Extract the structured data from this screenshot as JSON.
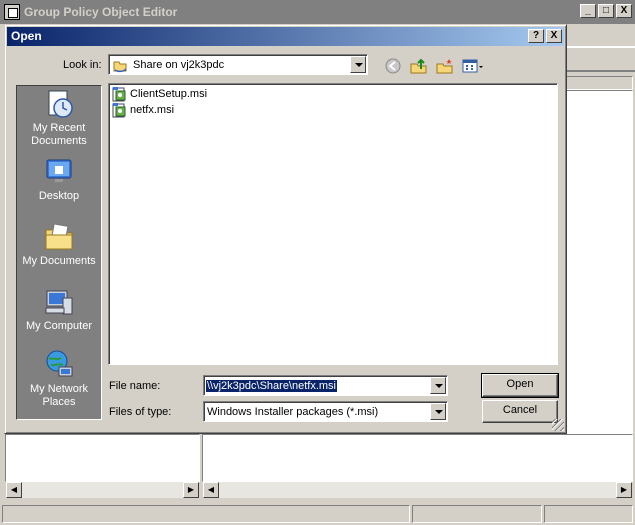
{
  "background_window": {
    "title": "Group Policy Object Editor",
    "caption_buttons": [
      "_",
      "□",
      "X"
    ]
  },
  "dialog": {
    "title": "Open",
    "title_buttons": [
      "?",
      "X"
    ],
    "look_in_label": "Look in:",
    "look_in_value": "Share on vj2k3pdc",
    "toolbar_icons": [
      "back-icon",
      "up-folder-icon",
      "new-folder-icon",
      "view-menu-icon"
    ],
    "places": [
      {
        "label_line1": "My Recent",
        "label_line2": "Documents",
        "icon": "recent-documents-icon"
      },
      {
        "label_line1": "Desktop",
        "label_line2": "",
        "icon": "desktop-icon"
      },
      {
        "label_line1": "My Documents",
        "label_line2": "",
        "icon": "my-documents-icon"
      },
      {
        "label_line1": "My Computer",
        "label_line2": "",
        "icon": "my-computer-icon"
      },
      {
        "label_line1": "My Network",
        "label_line2": "Places",
        "icon": "network-places-icon"
      }
    ],
    "files": [
      {
        "name": "ClientSetup.msi",
        "icon": "msi-package-icon"
      },
      {
        "name": "netfx.msi",
        "icon": "msi-package-icon"
      }
    ],
    "file_name_label": "File name:",
    "file_name_value": "\\\\vj2k3pdc\\Share\\netfx.msi",
    "file_type_label": "Files of type:",
    "file_type_value": "Windows Installer packages (*.msi)",
    "open_button": "Open",
    "cancel_button": "Cancel"
  },
  "colors": {
    "title_active": "#0a246a",
    "title_gradient_end": "#a6caf0",
    "title_inactive": "#808080",
    "face": "#d4d0c8",
    "places_bar": "#808080"
  }
}
